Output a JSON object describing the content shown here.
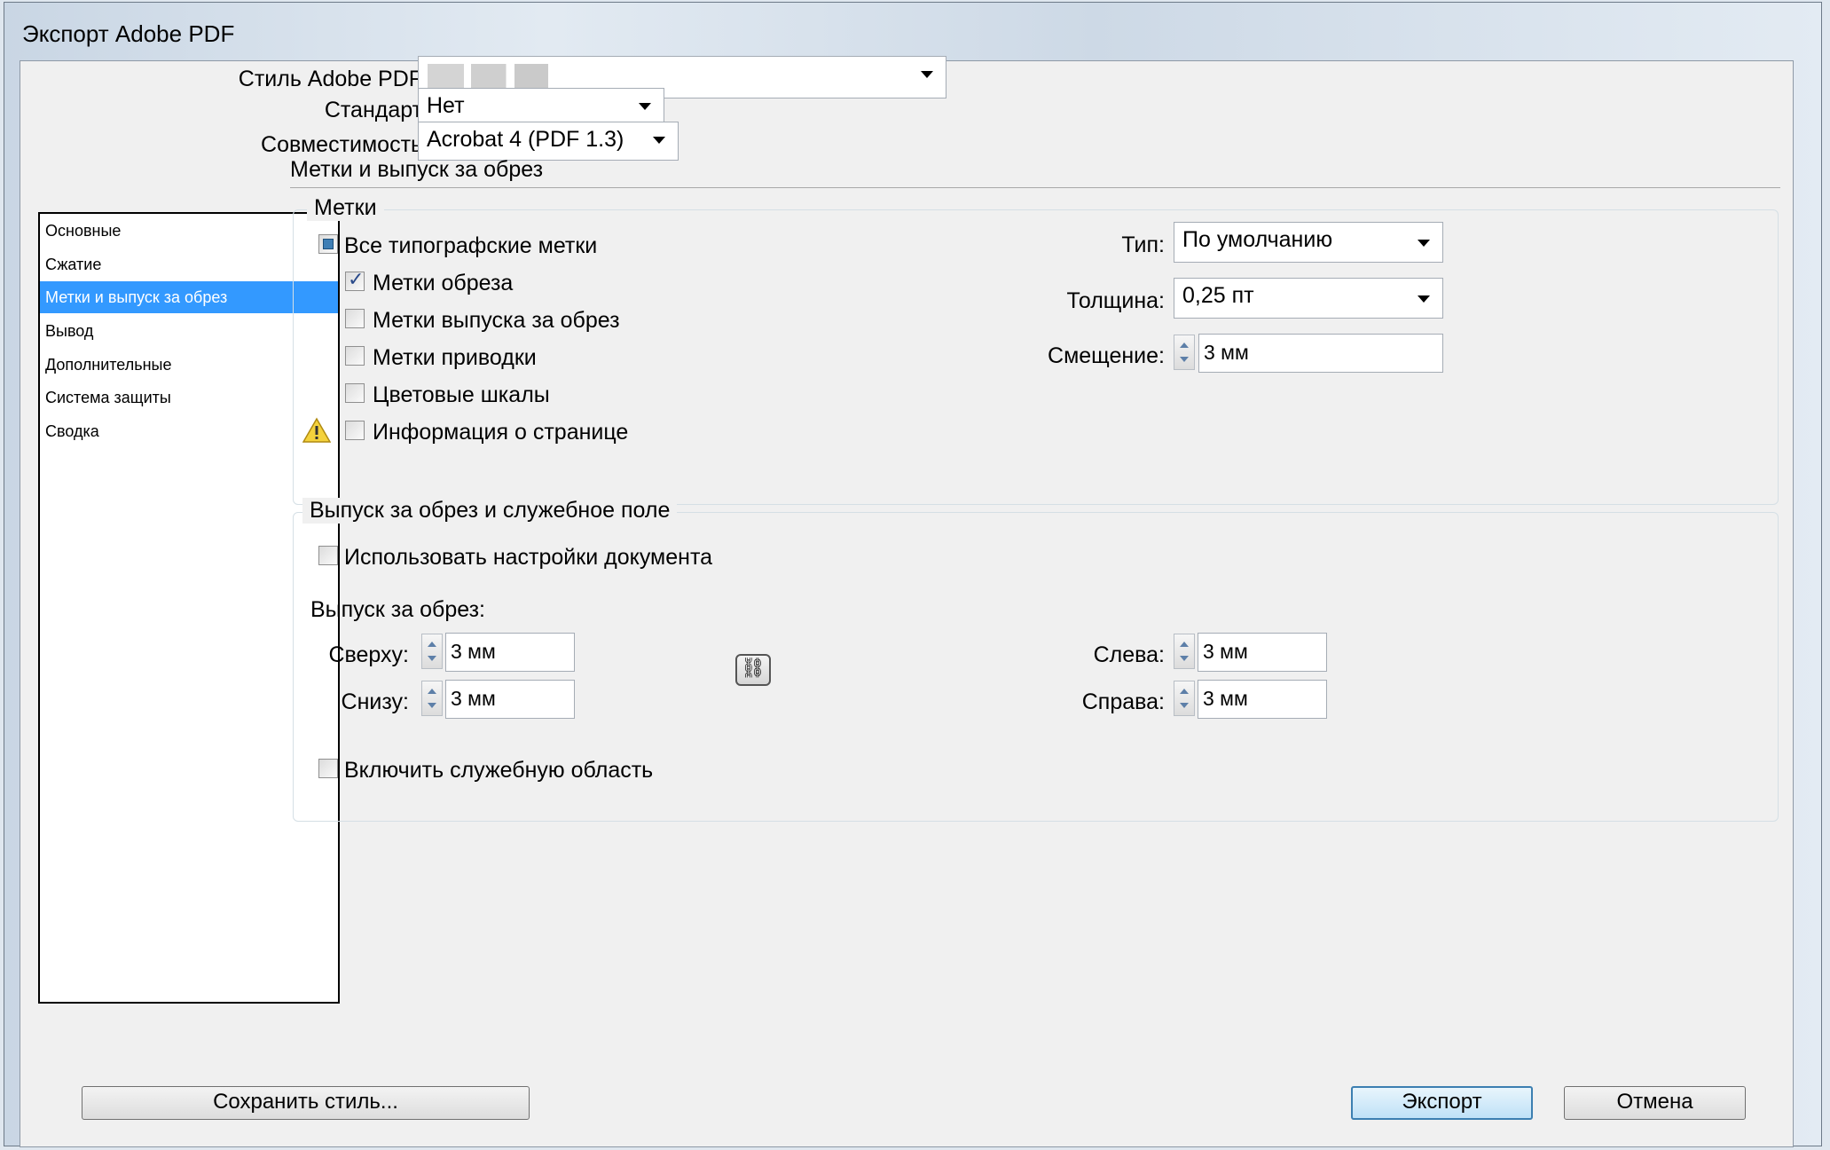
{
  "window": {
    "title": "Экспорт Adobe PDF"
  },
  "header": {
    "style_label": "Стиль Adobe PDF:",
    "style_value": "",
    "standard_label": "Стандарт:",
    "standard_value": "Нет",
    "compat_label": "Совместимость:",
    "compat_value": "Acrobat 4 (PDF 1.3)"
  },
  "sidebar": {
    "items": [
      {
        "label": "Основные"
      },
      {
        "label": "Сжатие"
      },
      {
        "label": "Метки и выпуск за обрез"
      },
      {
        "label": "Вывод"
      },
      {
        "label": "Дополнительные"
      },
      {
        "label": "Система защиты"
      },
      {
        "label": "Сводка"
      }
    ],
    "selected_index": 2,
    "warning_icon": "warning-icon"
  },
  "section": {
    "title": "Метки и выпуск за обрез"
  },
  "marks": {
    "legend": "Метки",
    "all_marks": "Все типографские метки",
    "crop_marks": "Метки обреза",
    "bleed_marks": "Метки выпуска за обрез",
    "registration_marks": "Метки приводки",
    "color_bars": "Цветовые шкалы",
    "page_info": "Информация о странице",
    "type_label": "Тип:",
    "type_value": "По умолчанию",
    "weight_label": "Толщина:",
    "weight_value": "0,25 пт",
    "offset_label": "Смещение:",
    "offset_value": "3 мм"
  },
  "bleed": {
    "legend": "Выпуск за обрез и служебное поле",
    "use_doc_settings": "Использовать настройки документа",
    "bleed_label": "Выпуск за обрез:",
    "top_label": "Сверху:",
    "top_value": "3 мм",
    "bottom_label": "Снизу:",
    "bottom_value": "3 мм",
    "left_label": "Слева:",
    "left_value": "3 мм",
    "right_label": "Справа:",
    "right_value": "3 мм",
    "include_slug": "Включить служебную область"
  },
  "footer": {
    "save_style": "Сохранить стиль...",
    "export": "Экспорт",
    "cancel": "Отмена"
  }
}
